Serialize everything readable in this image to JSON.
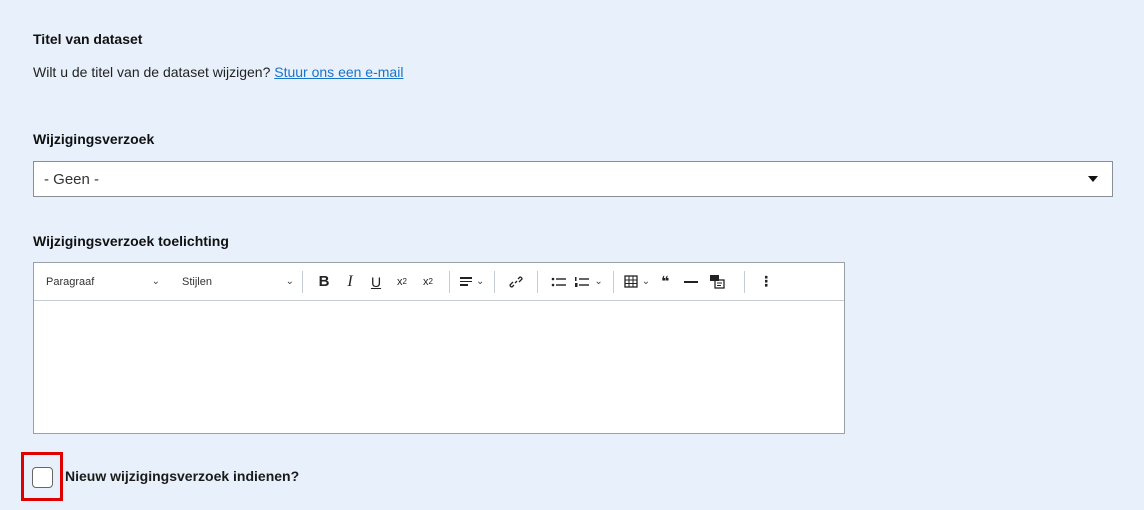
{
  "dataset_title": {
    "heading": "Titel van dataset",
    "help_text": "Wilt u de titel van de dataset wijzigen?",
    "help_link": "Stuur ons een e-mail"
  },
  "change_request": {
    "label": "Wijzigingsverzoek",
    "selected": "- Geen -"
  },
  "explanation": {
    "label": "Wijzigingsverzoek toelichting",
    "toolbar": {
      "paragraph": "Paragraaf",
      "styles": "Stijlen",
      "bold": "B",
      "italic": "I",
      "underline": "U",
      "superscript": "x",
      "superscript_mark": "2",
      "subscript": "x",
      "subscript_mark": "2",
      "quote": "❝",
      "more": "⋮"
    }
  },
  "new_request": {
    "label": "Nieuw wijzigingsverzoek indienen?",
    "checked": false
  },
  "colors": {
    "background": "#e8f1fb",
    "link": "#1a73c8",
    "highlight": "#e00000"
  }
}
